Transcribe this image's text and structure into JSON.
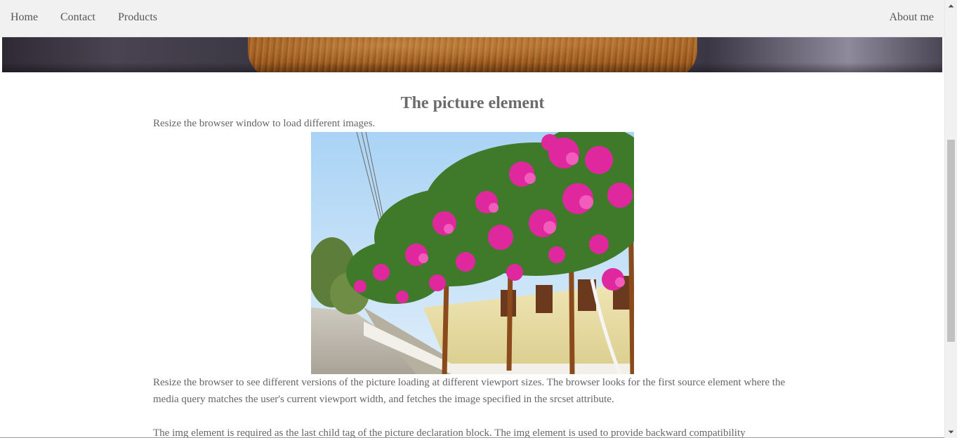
{
  "nav": {
    "home": "Home",
    "contact": "Contact",
    "products": "Products",
    "about": "About me"
  },
  "main": {
    "heading": "The picture element",
    "intro": "Resize the browser window to load different images.",
    "paragraph1": "Resize the browser to see different versions of the picture loading at different viewport sizes. The browser looks for the first source element where the media query matches the user's current viewport width, and fetches the image specified in the srcset attribute.",
    "paragraph2": "The img element is required as the last child tag of the picture declaration block. The img element is used to provide backward compatibility"
  },
  "icons": {
    "scroll_up": "triangle-up-icon",
    "scroll_down": "triangle-down-icon"
  },
  "colors": {
    "nav_background": "#f1f1f1",
    "text": "#555555",
    "bougainvillea_pink": "#e0289e"
  }
}
